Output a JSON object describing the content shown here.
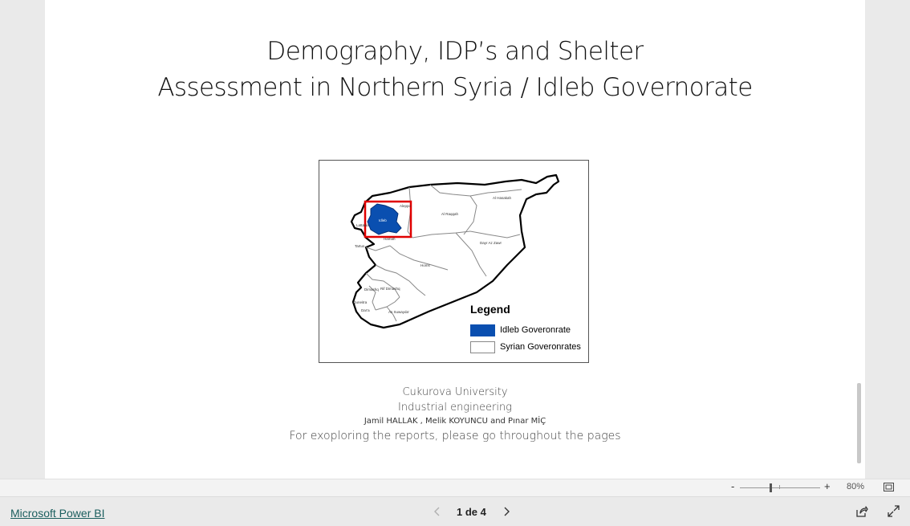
{
  "report": {
    "title_line1": "Demography, IDP’s and Shelter",
    "title_line2": "Assessment in Northern Syria / Idleb Governorate",
    "map": {
      "region_labels": [
        {
          "text": "Aleppo"
        },
        {
          "text": "Al Raqqah"
        },
        {
          "text": "Al Hasakah"
        },
        {
          "text": "Idleb"
        },
        {
          "text": "Lattakia"
        },
        {
          "text": "Hamah"
        },
        {
          "text": "Tartus"
        },
        {
          "text": "Homs"
        },
        {
          "text": "Dayr Az Zawr"
        },
        {
          "text": "Rif Dimashq"
        },
        {
          "text": "Dimashq"
        },
        {
          "text": "Quneitra"
        },
        {
          "text": "Dar'a"
        },
        {
          "text": "As Suwayda'"
        }
      ],
      "legend": {
        "title": "Legend",
        "items": [
          {
            "label": "Idleb Goveronrate",
            "color": "#0a4fb0"
          },
          {
            "label": "Syrian Goveronrates",
            "color": "#ffffff"
          }
        ]
      },
      "highlight_color": "#0a4fb0",
      "highlight_box_color": "#e00000"
    },
    "credits": {
      "university": "Cukurova University",
      "department": "Industrial engineering",
      "authors": "Jamil HALLAK , Melik KOYUNCU and Pınar MİÇ",
      "instruction": "For exoploring the reports, please go throughout the pages"
    }
  },
  "zoom": {
    "minus": "-",
    "plus": "+",
    "level": "80%",
    "level_fraction": 0.38
  },
  "footer": {
    "brand": "Microsoft Power BI",
    "page_indicator": "1 de 4"
  },
  "icons": {
    "fit": "fit-to-page-icon",
    "prev": "chevron-left-icon",
    "next": "chevron-right-icon",
    "share": "share-icon",
    "fullscreen": "fullscreen-icon"
  }
}
